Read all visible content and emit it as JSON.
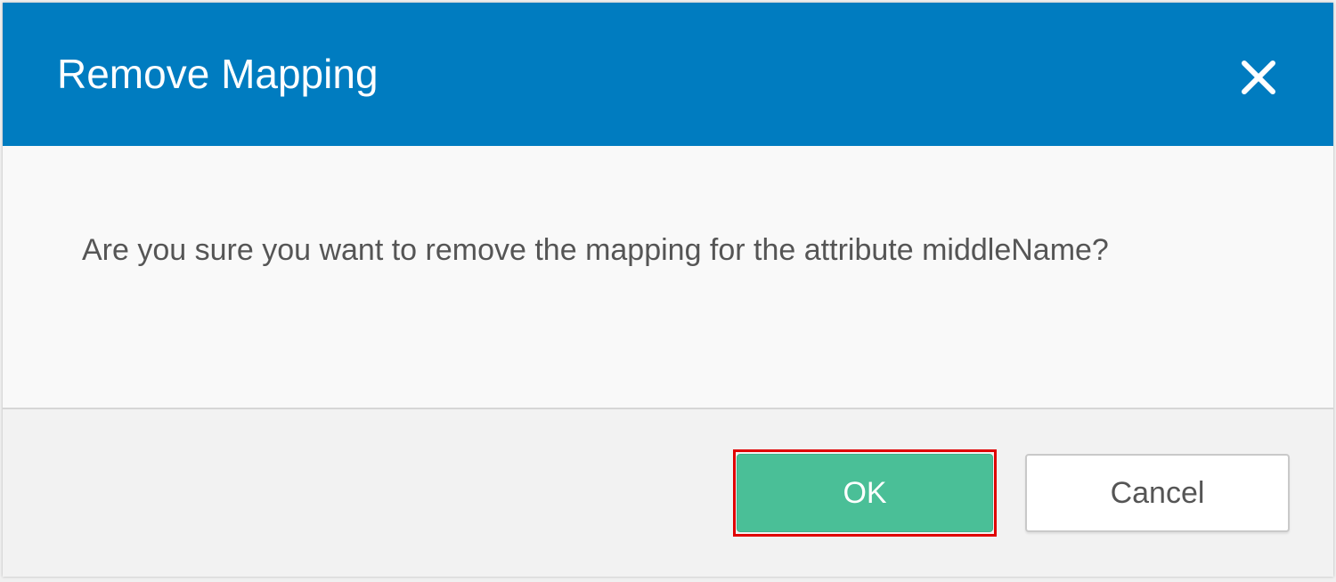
{
  "dialog": {
    "title": "Remove Mapping",
    "close_icon": "close-icon",
    "message": "Are you sure you want to remove the mapping for the attribute middleName?",
    "buttons": {
      "ok_label": "OK",
      "cancel_label": "Cancel"
    },
    "colors": {
      "header": "#007cc0",
      "ok_button": "#4abf97",
      "ok_highlight": "#e00000"
    }
  }
}
